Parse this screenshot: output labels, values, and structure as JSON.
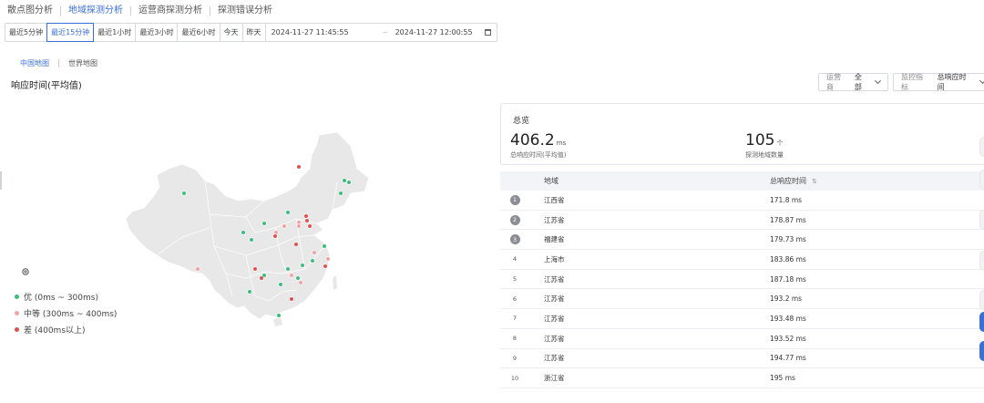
{
  "tabs": [
    {
      "label": "散点图分析",
      "active": false
    },
    {
      "label": "地域探测分析",
      "active": true
    },
    {
      "label": "运营商探测分析",
      "active": false
    },
    {
      "label": "探测错误分析",
      "active": false
    }
  ],
  "time_buttons": [
    {
      "label": "最近5分钟",
      "active": false
    },
    {
      "label": "最近15分钟",
      "active": true
    },
    {
      "label": "最近1小时",
      "active": false
    },
    {
      "label": "最近3小时",
      "active": false
    },
    {
      "label": "最近6小时",
      "active": false
    },
    {
      "label": "今天",
      "active": false
    },
    {
      "label": "昨天",
      "active": false
    }
  ],
  "date_range": {
    "start": "2024-11-27 11:45:55",
    "separator": "~",
    "end": "2024-11-27 12:00:55"
  },
  "map_tabs": [
    {
      "label": "中国地图",
      "active": true
    },
    {
      "label": "世界地图",
      "active": false
    }
  ],
  "section_title": "响应时间(平均值)",
  "filters": {
    "operator": {
      "label": "运营商",
      "value": "全部"
    },
    "metric": {
      "label": "监控指标",
      "value": "总响应时间"
    }
  },
  "legend": [
    {
      "label": "优 (0ms ~ 300ms)",
      "color": "#3dbd7d"
    },
    {
      "label": "中等 (300ms ~ 400ms)",
      "color": "#f2a3a7"
    },
    {
      "label": "差 (400ms以上)",
      "color": "#e0524f"
    }
  ],
  "colors": {
    "accent": "#3a6fd8",
    "good": "#3dbd7d",
    "medium": "#f2a3a7",
    "bad": "#e0524f",
    "map_fill": "#e8e8e8"
  },
  "summary": {
    "title": "总览",
    "avg_response": {
      "value": "406.2",
      "unit": "ms",
      "desc": "总响应时间(平均值)"
    },
    "region_count": {
      "value": "105",
      "unit": "个",
      "desc": "探测地域数量"
    }
  },
  "table": {
    "columns": [
      "地域",
      "总响应时间"
    ],
    "rows": [
      {
        "rank": "1",
        "region": "江西省",
        "time": "171.8 ms"
      },
      {
        "rank": "2",
        "region": "江苏省",
        "time": "178.87 ms"
      },
      {
        "rank": "3",
        "region": "福建省",
        "time": "179.73 ms"
      },
      {
        "rank": "4",
        "region": "上海市",
        "time": "183.86 ms"
      },
      {
        "rank": "5",
        "region": "江苏省",
        "time": "187.18 ms"
      },
      {
        "rank": "6",
        "region": "江苏省",
        "time": "193.2 ms"
      },
      {
        "rank": "7",
        "region": "江苏省",
        "time": "193.48 ms"
      },
      {
        "rank": "8",
        "region": "江苏省",
        "time": "193.52 ms"
      },
      {
        "rank": "9",
        "region": "江苏省",
        "time": "194.77 ms"
      },
      {
        "rank": "10",
        "region": "浙江省",
        "time": "195 ms"
      }
    ]
  },
  "map_points": [
    {
      "status": "bad"
    },
    {
      "status": "good"
    },
    {
      "status": "good"
    },
    {
      "status": "good"
    },
    {
      "status": "good"
    },
    {
      "status": "bad"
    },
    {
      "status": "medium"
    },
    {
      "status": "bad"
    },
    {
      "status": "good"
    },
    {
      "status": "medium"
    },
    {
      "status": "medium"
    },
    {
      "status": "bad"
    },
    {
      "status": "good"
    },
    {
      "status": "medium"
    },
    {
      "status": "bad"
    },
    {
      "status": "good"
    },
    {
      "status": "bad"
    },
    {
      "status": "good"
    },
    {
      "status": "medium"
    },
    {
      "status": "good"
    },
    {
      "status": "good"
    },
    {
      "status": "medium"
    },
    {
      "status": "bad"
    },
    {
      "status": "good"
    },
    {
      "status": "bad"
    },
    {
      "status": "good"
    },
    {
      "status": "medium"
    },
    {
      "status": "good"
    },
    {
      "status": "good"
    },
    {
      "status": "bad"
    },
    {
      "status": "medium"
    },
    {
      "status": "good"
    },
    {
      "status": "bad"
    },
    {
      "status": "good"
    },
    {
      "status": "medium"
    },
    {
      "status": "good"
    }
  ]
}
